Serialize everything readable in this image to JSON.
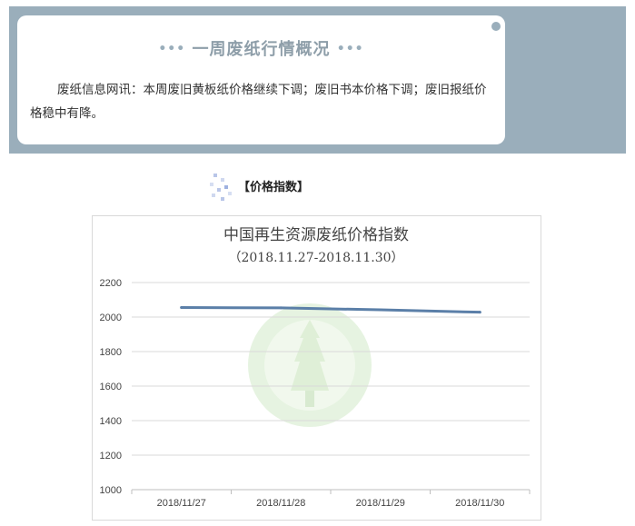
{
  "card": {
    "title": "一周废纸行情概况",
    "title_dots_left": "•••",
    "title_dots_right": "•••",
    "text": "废纸信息网讯：本周废旧黄板纸价格继续下调；废旧书本价格下调；废旧报纸价格稳中有降。"
  },
  "section": {
    "label": "【价格指数】"
  },
  "colors": {
    "banner": "#9aaebb",
    "line": "#5b7fa8",
    "watermark": "#cfe7c4"
  },
  "chart_data": {
    "type": "line",
    "title": "中国再生资源废纸价格指数",
    "subtitle": "（2018.11.27-2018.11.30）",
    "categories": [
      "2018/11/27",
      "2018/11/28",
      "2018/11/29",
      "2018/11/30"
    ],
    "series": [
      {
        "values": [
          2055,
          2053,
          2042,
          2028
        ]
      }
    ],
    "ylim": [
      1000,
      2200
    ],
    "yticks": [
      "1000",
      "1200",
      "1400",
      "1600",
      "1800",
      "2000",
      "2200"
    ],
    "grid": true,
    "xlabel": "",
    "ylabel": ""
  }
}
